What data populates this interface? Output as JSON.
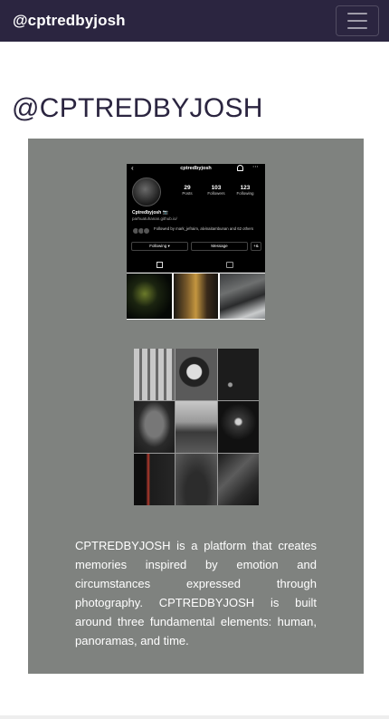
{
  "navbar": {
    "brand": "@cptredbyjosh",
    "toggler_icon": "hamburger-menu-icon",
    "bg_color": "#2b2540"
  },
  "main": {
    "heading": "@CPTREDBYJOSH",
    "card_bg_color": "#7f827f",
    "profile_screenshot": {
      "username": "cptredbyjosh",
      "stats": [
        {
          "value": "29",
          "label": "Posts"
        },
        {
          "value": "103",
          "label": "Followers"
        },
        {
          "value": "123",
          "label": "Following"
        }
      ],
      "display_name": "Cptredbyjosh 📷",
      "website": "parhuatuhanan.github.io/",
      "followed_by": "Followed by mark_jefraim, alvinaitambunan and 62 others",
      "following_button": "Following ▾",
      "message_button": "Message",
      "add_button": "+&"
    },
    "description": "CPTREDBYJOSH is a platform that creates memories inspired by emotion and circumstances expressed through photography. CPTREDBYJOSH is built around three fundamental elements: human, panoramas, and time."
  }
}
